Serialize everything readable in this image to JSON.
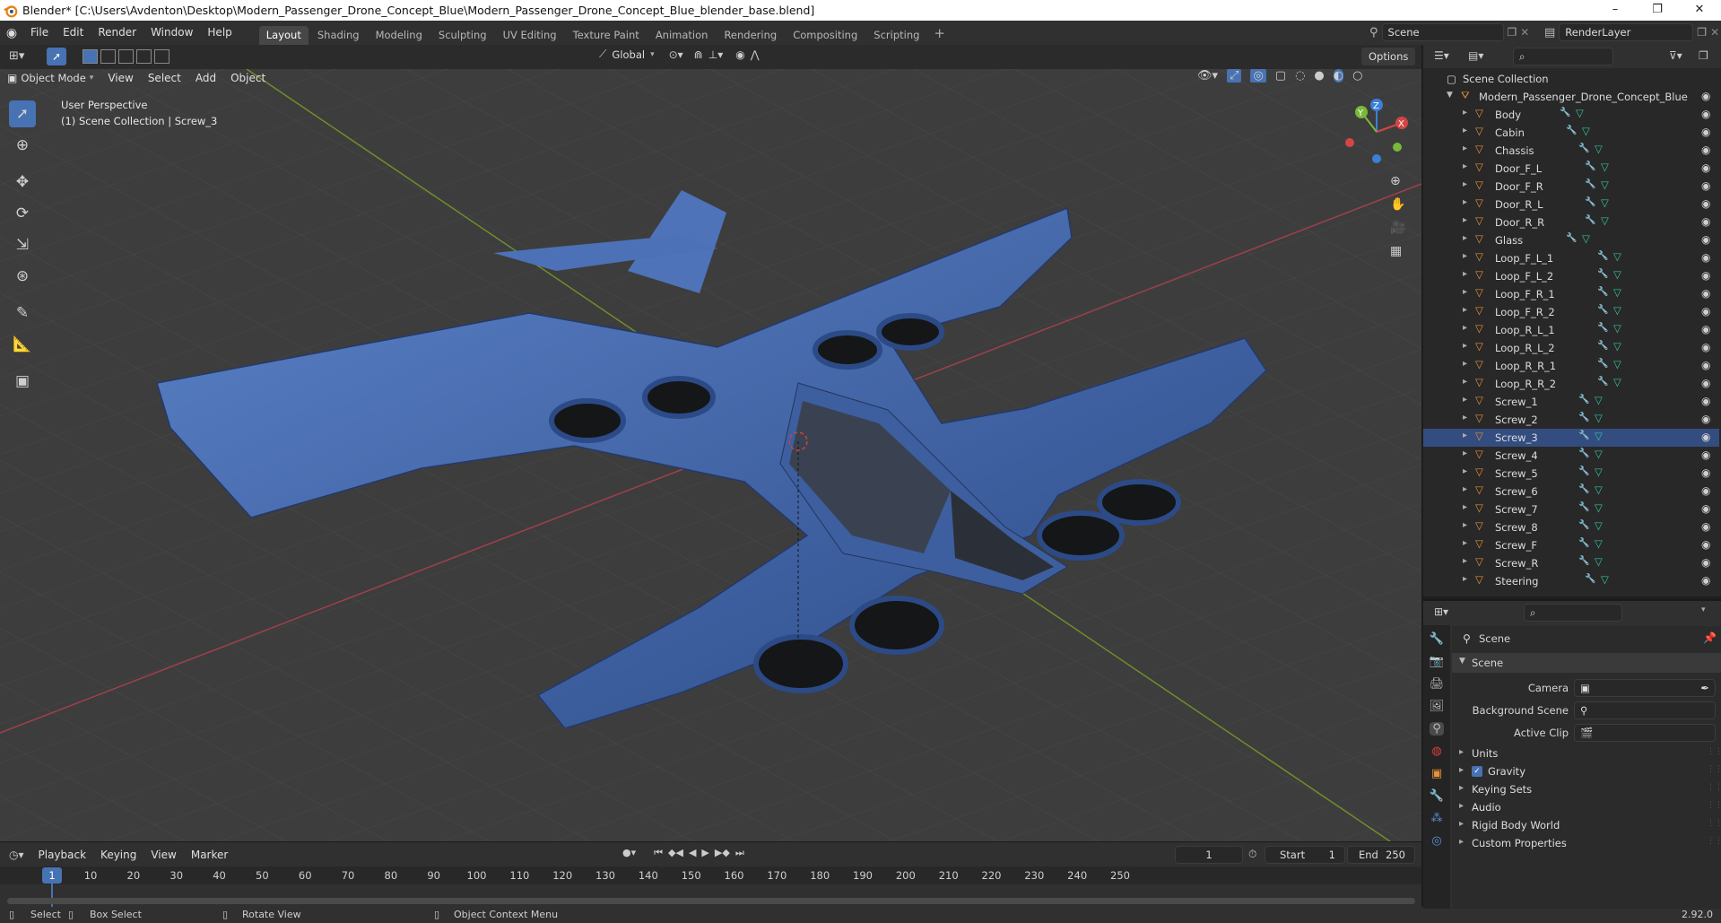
{
  "window": {
    "title": "Blender* [C:\\Users\\Avdenton\\Desktop\\Modern_Passenger_Drone_Concept_Blue\\Modern_Passenger_Drone_Concept_Blue_blender_base.blend]",
    "minimize": "–",
    "maximize": "❐",
    "close": "✕"
  },
  "menubar": {
    "items": [
      "File",
      "Edit",
      "Render",
      "Window",
      "Help"
    ],
    "workspaces": [
      "Layout",
      "Shading",
      "Modeling",
      "Sculpting",
      "UV Editing",
      "Texture Paint",
      "Animation",
      "Rendering",
      "Compositing",
      "Scripting"
    ],
    "active_workspace": "Layout",
    "add_workspace": "+",
    "scene": "Scene",
    "view_layer": "RenderLayer"
  },
  "viewport_header": {
    "mode": "Object Mode",
    "menus": [
      "View",
      "Select",
      "Add",
      "Object"
    ],
    "orientation": "Global",
    "options": "Options"
  },
  "viewport": {
    "perspective_label": "User Perspective",
    "context_label": "(1) Scene Collection | Screw_3",
    "axis_labels": {
      "x": "X",
      "y": "Y",
      "z": "Z"
    }
  },
  "outliner": {
    "root": "Scene Collection",
    "collection": "Modern_Passenger_Drone_Concept_Blue",
    "selected": "Screw_3",
    "objects": [
      "Body",
      "Cabin",
      "Chassis",
      "Door_F_L",
      "Door_F_R",
      "Door_R_L",
      "Door_R_R",
      "Glass",
      "Loop_F_L_1",
      "Loop_F_L_2",
      "Loop_F_R_1",
      "Loop_F_R_2",
      "Loop_R_L_1",
      "Loop_R_L_2",
      "Loop_R_R_1",
      "Loop_R_R_2",
      "Screw_1",
      "Screw_2",
      "Screw_3",
      "Screw_4",
      "Screw_5",
      "Screw_6",
      "Screw_7",
      "Screw_8",
      "Screw_F",
      "Screw_R",
      "Steering"
    ]
  },
  "properties": {
    "context_title": "Scene",
    "panel_title": "Scene",
    "camera_label": "Camera",
    "background_scene_label": "Background Scene",
    "active_clip_label": "Active Clip",
    "subpanels": [
      "Units",
      "Gravity",
      "Keying Sets",
      "Audio",
      "Rigid Body World",
      "Custom Properties"
    ],
    "gravity_checked": true
  },
  "timeline": {
    "menus": [
      "Playback",
      "Keying",
      "View",
      "Marker"
    ],
    "current_frame": "1",
    "start_label": "Start",
    "start": "1",
    "end_label": "End",
    "end": "250",
    "ruler_ticks": [
      "1",
      "10",
      "20",
      "30",
      "40",
      "50",
      "60",
      "70",
      "80",
      "90",
      "100",
      "110",
      "120",
      "130",
      "140",
      "150",
      "160",
      "170",
      "180",
      "190",
      "200",
      "210",
      "220",
      "230",
      "240",
      "250"
    ]
  },
  "statusbar": {
    "select": "Select",
    "box_select": "Box Select",
    "rotate_view": "Rotate View",
    "context_menu": "Object Context Menu",
    "version": "2.92.0"
  },
  "colors": {
    "drone_blue": "#3a5d9c",
    "x_axis": "#b0404a",
    "y_axis": "#7a9a30",
    "accent_blue": "#4772b3",
    "outliner_orange": "#e8913a",
    "outliner_green": "#34c1a0"
  }
}
